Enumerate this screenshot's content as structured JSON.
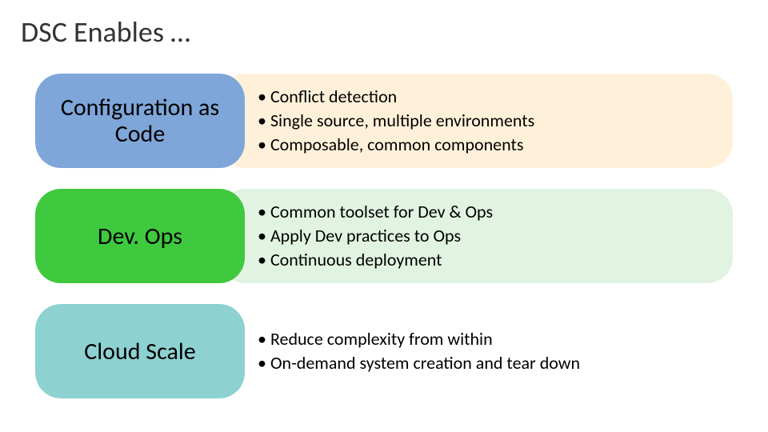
{
  "title": "DSC Enables …",
  "rows": [
    {
      "label": "Configuration as Code",
      "bullets": [
        "Conflict detection",
        "Single source, multiple environments",
        "Composable, common components"
      ]
    },
    {
      "label": "Dev. Ops",
      "bullets": [
        "Common toolset for Dev & Ops",
        "Apply Dev practices to Ops",
        "Continuous deployment"
      ]
    },
    {
      "label": "Cloud Scale",
      "bullets": [
        "Reduce complexity from within",
        "On-demand system creation and tear down"
      ]
    }
  ]
}
